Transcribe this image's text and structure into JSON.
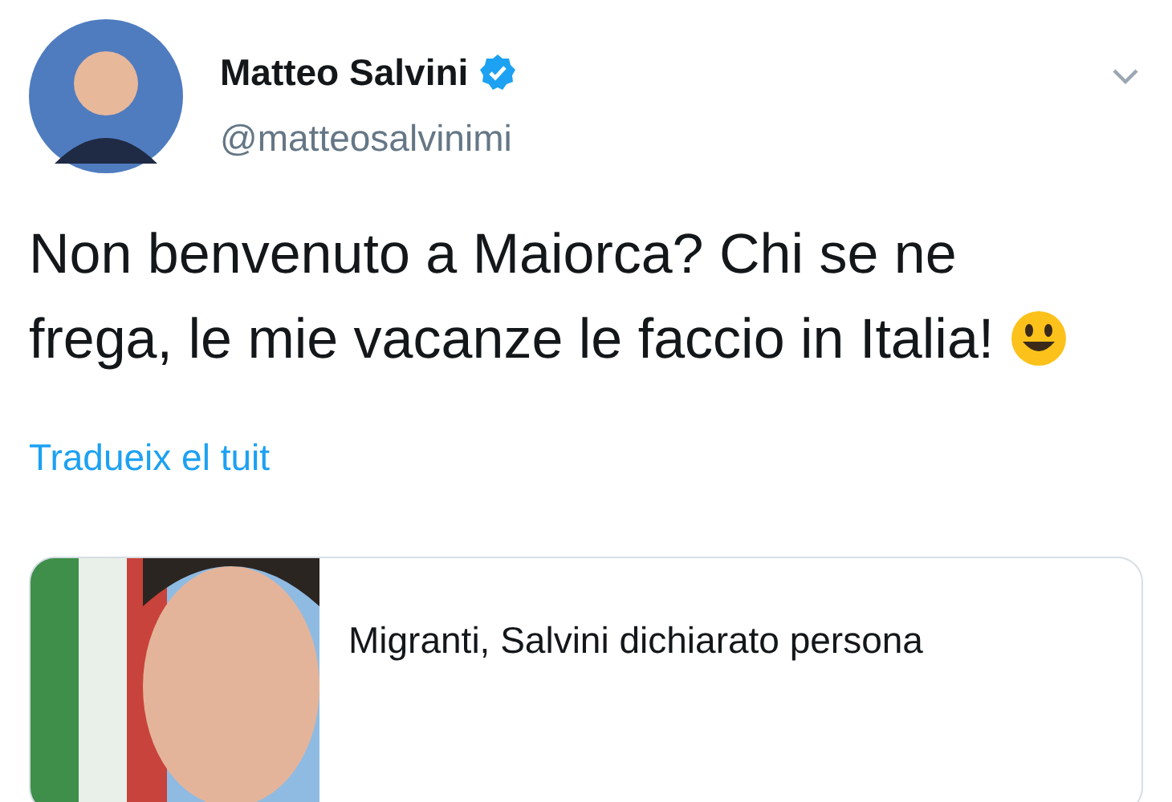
{
  "author": {
    "name": "Matteo Salvini",
    "verified": true,
    "handle": "@matteosalvinimi"
  },
  "tweet": {
    "text": "Non benvenuto a Maiorca? Chi se ne frega, le mie vacanze le faccio in Italia!"
  },
  "translate_link": "Tradueix el tuit",
  "link_card": {
    "title": "Migranti, Salvini dichiarato persona"
  }
}
